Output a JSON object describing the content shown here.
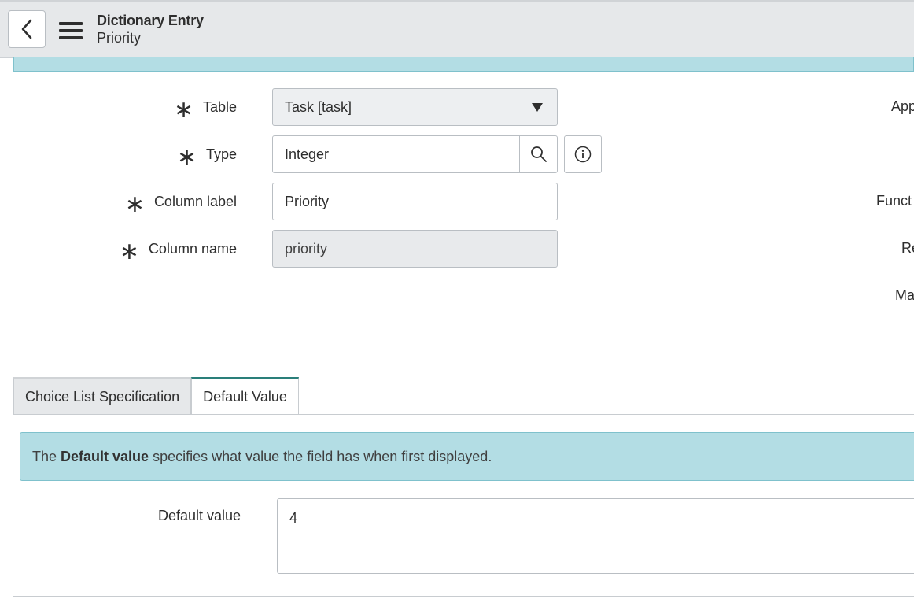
{
  "header": {
    "title": "Dictionary Entry",
    "subtitle": "Priority"
  },
  "form": {
    "required_marker": "∗",
    "table": {
      "label": "Table",
      "value": "Task [task]"
    },
    "type": {
      "label": "Type",
      "value": "Integer"
    },
    "column_label": {
      "label": "Column label",
      "value": "Priority"
    },
    "column_name": {
      "label": "Column name",
      "value": "priority"
    }
  },
  "right_column_labels": [
    "App",
    "Funct",
    "Re",
    "Ma"
  ],
  "tabs": [
    {
      "label": "Choice List Specification",
      "active": false
    },
    {
      "label": "Default Value",
      "active": true
    }
  ],
  "default_value_panel": {
    "info_prefix": "The",
    "info_bold": "Default value",
    "info_suffix": "specifies what value the field has when first displayed.",
    "field_label": "Default value",
    "field_value": "4"
  },
  "colors": {
    "header_bg": "#e6e8ea",
    "info_bg": "#b3dde4",
    "active_tab_accent": "#2a7f7a"
  },
  "icons": {
    "back": "chevron-left-icon",
    "menu": "hamburger-menu-icon",
    "select": "triangle-down-icon",
    "lookup": "search-icon",
    "info": "info-circle-icon"
  }
}
